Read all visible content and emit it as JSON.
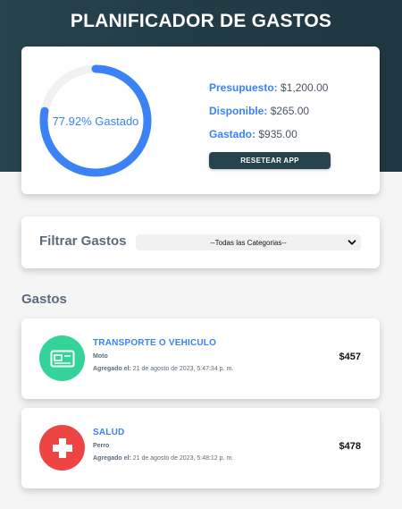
{
  "header": {
    "title": "PLANIFICADOR DE GASTOS"
  },
  "budget": {
    "percent_label": "77.92% Gastado",
    "percent_spent": 77.92,
    "presupuesto_label": "Presupuesto:",
    "presupuesto_value": "$1,200.00",
    "disponible_label": "Disponible:",
    "disponible_value": "$265.00",
    "gastado_label": "Gastado:",
    "gastado_value": "$935.00",
    "reset_label": "RESETEAR APP",
    "ring_color": "#3b82f6",
    "ring_track_color": "#f1f1f1"
  },
  "filter": {
    "label": "Filtrar Gastos",
    "selected_option": "--Todas las Categorias--"
  },
  "expenses_section": {
    "title": "Gastos"
  },
  "expenses": [
    {
      "category": "TRANSPORTE O VEHICULO",
      "name": "Moto",
      "added_label": "Agregado el:",
      "date": "21 de agosto de 2023, 5:47:34 p. m.",
      "amount": "$457",
      "icon": "vehicle-card-icon",
      "icon_color": "#34d399"
    },
    {
      "category": "SALUD",
      "name": "Perro",
      "added_label": "Agregado el:",
      "date": "21 de agosto de 2023, 5:48:12 p. m.",
      "amount": "$478",
      "icon": "health-cross-icon",
      "icon_color": "#ef4444"
    }
  ],
  "colors": {
    "header_bg": "#27434e",
    "accent": "#3b82f6",
    "page_bg": "#f5f5f5"
  }
}
